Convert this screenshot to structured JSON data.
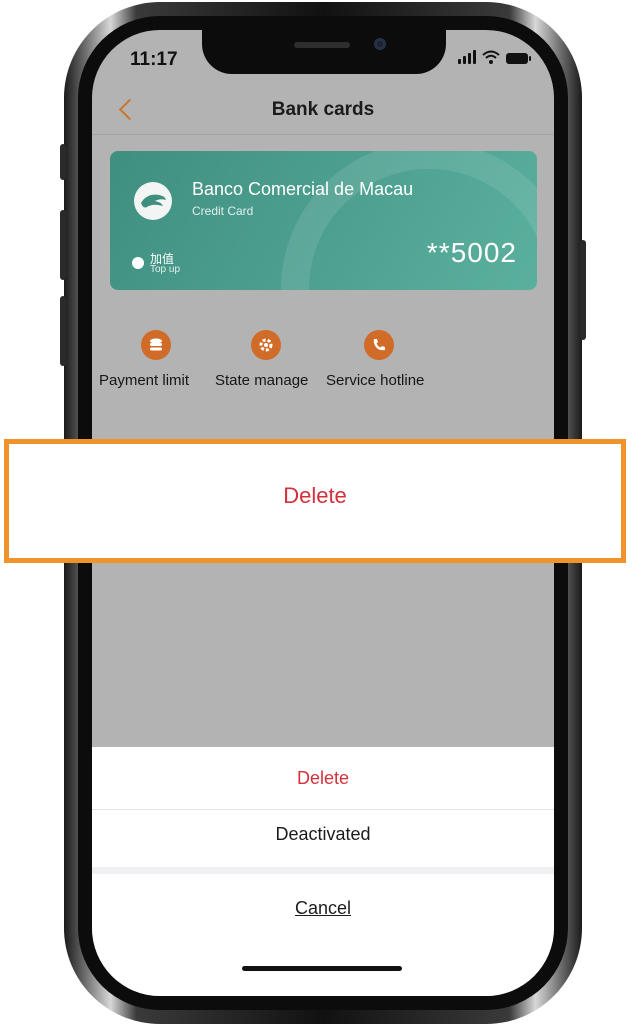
{
  "status_bar": {
    "time": "11:17"
  },
  "nav": {
    "title": "Bank cards"
  },
  "card": {
    "bank_name": "Banco Comercial de Macau",
    "card_type": "Credit Card",
    "number_masked": "**5002",
    "topup_label_cn": "加值",
    "topup_label_en": "Top up",
    "colors": {
      "card": "#4ea191",
      "accent": "#d06b28"
    }
  },
  "actions": [
    {
      "label": "Payment limit",
      "icon": "coins-icon"
    },
    {
      "label": "State manage",
      "icon": "gear-icon"
    },
    {
      "label": "Service hotline",
      "icon": "phone-icon"
    }
  ],
  "action_sheet": {
    "delete_label": "Delete",
    "deactivate_label": "Deactivated",
    "cancel_label": "Cancel"
  },
  "callout": {
    "label": "Delete",
    "border_color": "#f0932b",
    "text_color": "#d4303a"
  }
}
